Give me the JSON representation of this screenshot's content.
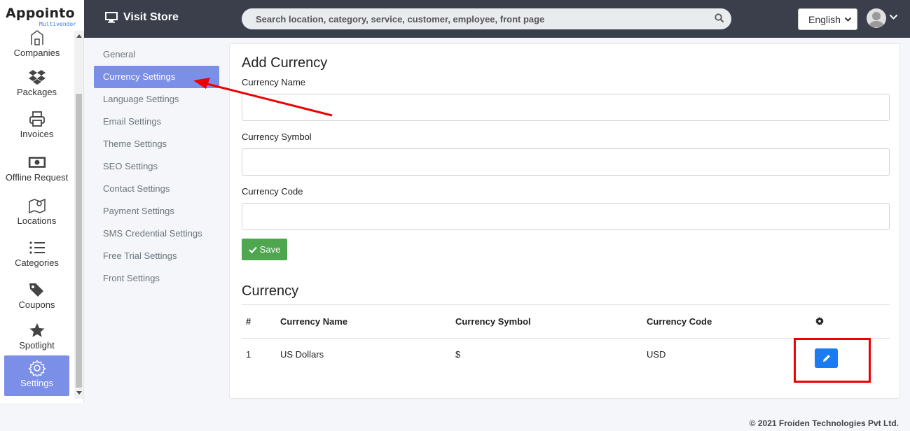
{
  "app": {
    "brand_main": "Appointo",
    "brand_sub": "Multivendor"
  },
  "sidebar": {
    "items": [
      {
        "label": "Companies",
        "icon": "building-icon"
      },
      {
        "label": "Packages",
        "icon": "dropbox-icon"
      },
      {
        "label": "Invoices",
        "icon": "printer-icon"
      },
      {
        "label": "Offline Request",
        "icon": "money-icon"
      },
      {
        "label": "Locations",
        "icon": "map-pin-icon"
      },
      {
        "label": "Categories",
        "icon": "list-icon"
      },
      {
        "label": "Coupons",
        "icon": "tags-icon"
      },
      {
        "label": "Spotlight",
        "icon": "star-icon"
      },
      {
        "label": "Settings",
        "icon": "gear-icon",
        "active": true
      }
    ]
  },
  "topbar": {
    "visit_store": "Visit Store",
    "search_placeholder": "Search location, category, service, customer, employee, front page",
    "language": "English"
  },
  "subnav": {
    "items": [
      "General",
      "Currency Settings",
      "Language Settings",
      "Email Settings",
      "Theme Settings",
      "SEO Settings",
      "Contact Settings",
      "Payment Settings",
      "SMS Credential Settings",
      "Free Trial Settings",
      "Front Settings"
    ],
    "active_index": 1
  },
  "form": {
    "title": "Add Currency",
    "name_label": "Currency Name",
    "name_value": "",
    "symbol_label": "Currency Symbol",
    "symbol_value": "",
    "code_label": "Currency Code",
    "code_value": "",
    "save_label": "Save"
  },
  "table": {
    "title": "Currency",
    "headers": [
      "#",
      "Currency Name",
      "Currency Symbol",
      "Currency Code"
    ],
    "settings_icon": "gear-icon",
    "rows": [
      {
        "index": "1",
        "name": "US Dollars",
        "symbol": "$",
        "code": "USD"
      }
    ]
  },
  "footer": {
    "copyright": "© 2021 Froiden Technologies Pvt Ltd."
  },
  "colors": {
    "topbar": "#3a3f4b",
    "active": "#7b8ee8",
    "save": "#4ea64e",
    "edit": "#1a7cf0",
    "annotation": "#e00000"
  }
}
